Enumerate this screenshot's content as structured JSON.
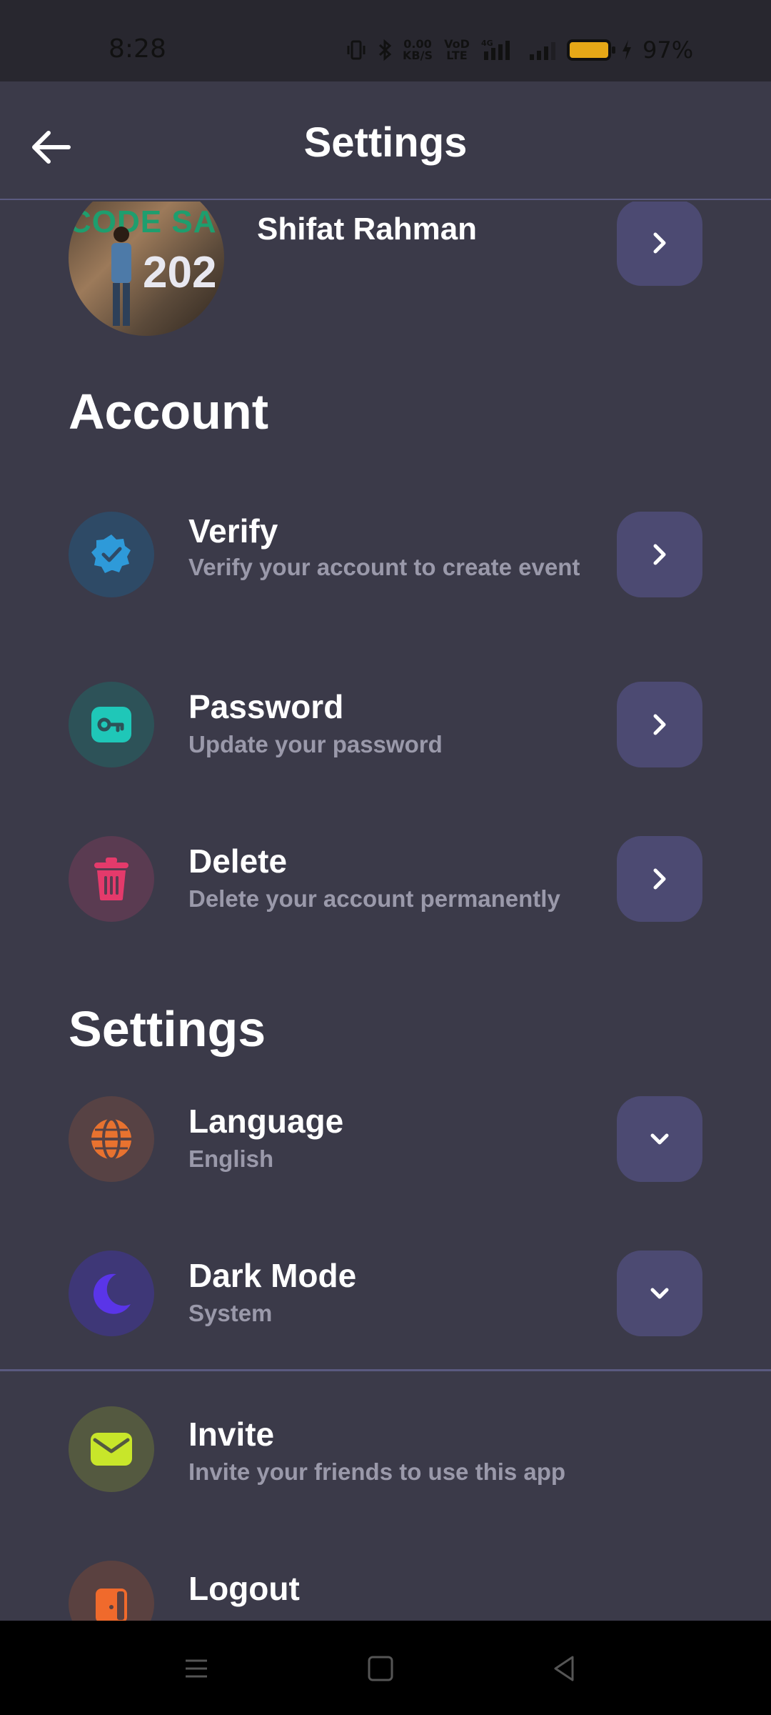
{
  "status": {
    "time": "8:28",
    "net_speed": "0.00",
    "net_unit": "KB/S",
    "volte": "VoD LTE",
    "network": "4G",
    "battery_pct": "97%"
  },
  "appbar": {
    "title": "Settings"
  },
  "profile": {
    "name": "Shifat Rahman",
    "sign_text": "CODE SA",
    "sign_year": "202"
  },
  "account": {
    "title": "Account",
    "items": [
      {
        "title": "Verify",
        "subtitle": "Verify your account to create event",
        "icon": "verified-badge-icon",
        "color": "#2e9ad9"
      },
      {
        "title": "Password",
        "subtitle": "Update your password",
        "icon": "key-icon",
        "color": "#1fc7b8"
      },
      {
        "title": "Delete",
        "subtitle": "Delete your account permanently",
        "icon": "trash-icon",
        "color": "#e43a6b"
      }
    ]
  },
  "settings": {
    "title": "Settings",
    "items": [
      {
        "title": "Language",
        "subtitle": "English",
        "icon": "globe-icon",
        "color": "#e8722f"
      },
      {
        "title": "Dark Mode",
        "subtitle": "System",
        "icon": "moon-icon",
        "color": "#5a35e8"
      }
    ]
  },
  "more": {
    "items": [
      {
        "title": "Invite",
        "subtitle": "Invite your friends to use this app",
        "icon": "envelope-icon",
        "color": "#c8e62a"
      },
      {
        "title": "Logout",
        "subtitle": "",
        "icon": "door-icon",
        "color": "#f06a2c"
      }
    ]
  }
}
